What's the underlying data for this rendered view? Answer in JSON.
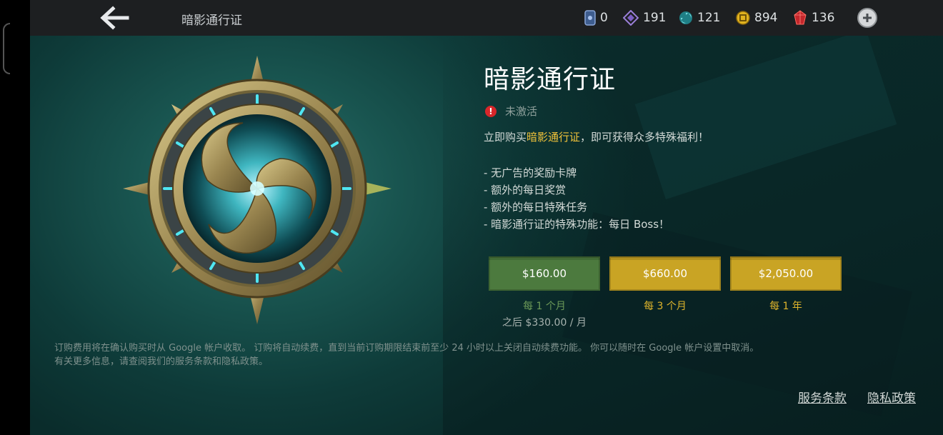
{
  "header": {
    "title": "暗影通行证",
    "currencies": [
      {
        "icon": "ticket-icon",
        "value": "0"
      },
      {
        "icon": "shard-icon",
        "value": "191"
      },
      {
        "icon": "essence-icon",
        "value": "121"
      },
      {
        "icon": "gold-coin-icon",
        "value": "894"
      },
      {
        "icon": "gem-icon",
        "value": "136"
      }
    ]
  },
  "pass": {
    "title": "暗影通行证",
    "status": "未激活",
    "intro_prefix": "立即购买",
    "intro_highlight": "暗影通行证",
    "intro_suffix": "，即可获得众多特殊福利！",
    "benefits": [
      "- 无广告的奖励卡牌",
      "- 额外的每日奖赏",
      "- 额外的每日特殊任务",
      "- 暗影通行证的特殊功能：每日 Boss！"
    ]
  },
  "plans": [
    {
      "price": "$160.00",
      "period": "每 1 个月",
      "note": "之后 $330.00 / 月",
      "color": "#4c7a3e"
    },
    {
      "price": "$660.00",
      "period": "每 3 个月",
      "color": "#c9a424"
    },
    {
      "price": "$2,050.00",
      "period": "每 1 年",
      "color": "#c9a424"
    }
  ],
  "disclaimer": {
    "line1": "订购费用将在确认购买时从 Google 帐户收取。 订购将自动续费，直到当前订购期限结束前至少 24 小时以上关闭自动续费功能。 你可以随时在 Google 帐户设置中取消。",
    "line2": "有关更多信息，请查阅我们的服务条款和隐私政策。"
  },
  "footer": {
    "terms": "服务条款",
    "privacy": "隐私政策"
  },
  "colors": {
    "accent_gold": "#f0c23a",
    "warning_red": "#d8262a",
    "plan_green": "#4c7a3e",
    "plan_gold": "#c9a424"
  }
}
